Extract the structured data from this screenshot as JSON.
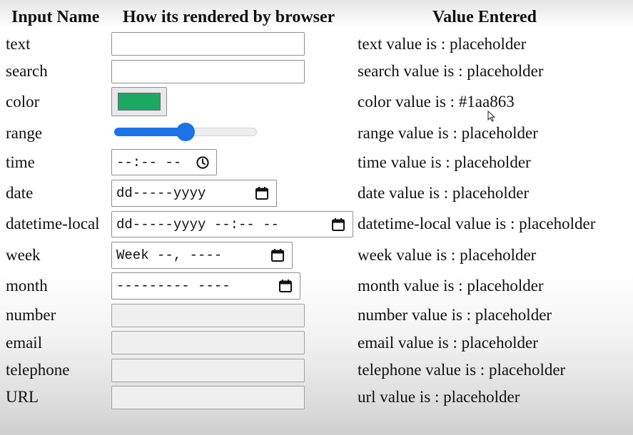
{
  "headers": {
    "input_name": "Input Name",
    "rendered": "How its rendered by browser",
    "value_entered": "Value Entered"
  },
  "rows": [
    {
      "label": "text",
      "value": "text value is : placeholder"
    },
    {
      "label": "search",
      "value": "search value is : placeholder"
    },
    {
      "label": "color",
      "value": "color value is : #1aa863"
    },
    {
      "label": "range",
      "value": "range value is : placeholder"
    },
    {
      "label": "time",
      "value": "time value is : placeholder"
    },
    {
      "label": "date",
      "value": "date value is : placeholder"
    },
    {
      "label": "datetime-local",
      "value": "datetime-local value is : placeholder"
    },
    {
      "label": "week",
      "value": "week value is : placeholder"
    },
    {
      "label": "month",
      "value": "month value is : placeholder"
    },
    {
      "label": "number",
      "value": "number value is : placeholder"
    },
    {
      "label": "email",
      "value": "email value is : placeholder"
    },
    {
      "label": "telephone",
      "value": "telephone value is : placeholder"
    },
    {
      "label": "URL",
      "value": "url value is : placeholder"
    }
  ],
  "controls": {
    "text_value": "",
    "search_value": "",
    "color_swatch": "#1aa863",
    "range_fraction": 0.5,
    "time_display": "--:-- --",
    "date_display": "dd-----yyyy",
    "datetime_local_display": "dd-----yyyy --:-- --",
    "week_display": "Week --, ----",
    "month_display": "--------- ----",
    "number_value": "",
    "email_value": "",
    "telephone_value": "",
    "url_value": ""
  },
  "colors": {
    "range_accent": "#1a73e8"
  },
  "icons": {
    "time": "clock-icon",
    "date": "calendar-icon",
    "cursor": "mouse-pointer-icon"
  }
}
